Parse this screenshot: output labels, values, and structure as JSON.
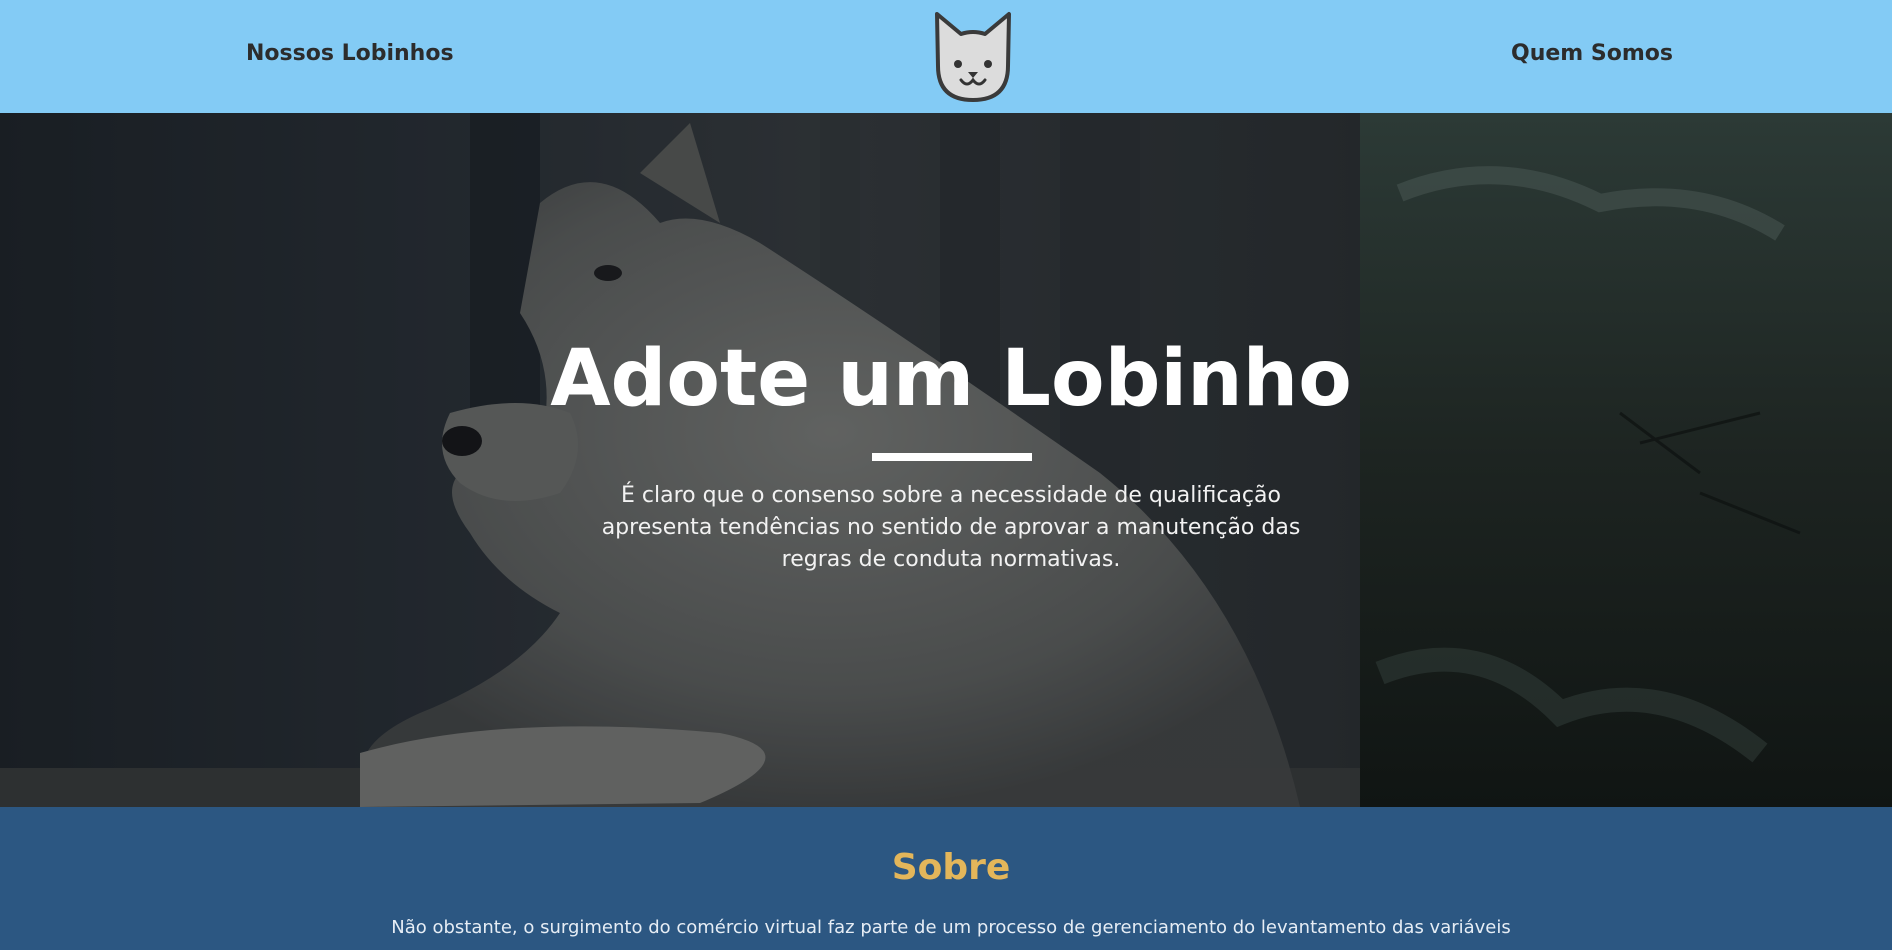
{
  "header": {
    "nav_left": "Nossos Lobinhos",
    "nav_right": "Quem Somos",
    "logo_icon": "cat-face-icon",
    "background_color": "#83cbf5"
  },
  "hero": {
    "title": "Adote um Lobinho",
    "text": "É claro que o consenso sobre a necessidade de qualificação apresenta tendências no sentido de aprovar a manutenção das regras de conduta normativas.",
    "image": "white-wolf-photo"
  },
  "about": {
    "title": "Sobre",
    "text": "Não obstante, o surgimento do comércio virtual faz parte de um processo de gerenciamento do levantamento das variáveis",
    "background_color": "#2c5782",
    "title_color": "#e3b65a"
  }
}
